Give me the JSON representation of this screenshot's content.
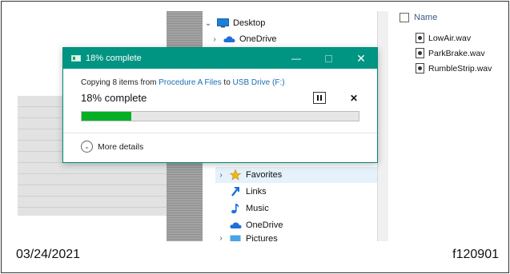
{
  "nav": {
    "items": [
      {
        "label": "Desktop",
        "icon": "desktop-icon",
        "chevron": "⌄"
      },
      {
        "label": "OneDrive",
        "icon": "cloud-icon",
        "chevron": "›"
      },
      {
        "label": "Favorites",
        "icon": "star-icon",
        "chevron": "›"
      },
      {
        "label": "Links",
        "icon": "link-icon",
        "chevron": ""
      },
      {
        "label": "Music",
        "icon": "music-note-icon",
        "chevron": ""
      },
      {
        "label": "OneDrive",
        "icon": "cloud-icon",
        "chevron": ""
      },
      {
        "label": "Pictures",
        "icon": "pictures-icon",
        "chevron": "›"
      }
    ]
  },
  "files": {
    "header": "Name",
    "items": [
      "LowAir.wav",
      "ParkBrake.wav",
      "RumbleStrip.wav"
    ]
  },
  "dialog": {
    "title": "18% complete",
    "copy_prefix": "Copying 8 items from",
    "source": "Procedure A Files",
    "to_word": "to",
    "destination": "USB Drive (F:)",
    "percent_label": "18% complete",
    "progress": 0.18,
    "more_details": "More details",
    "minimize_glyph": "—",
    "close_glyph": "✕",
    "cancel_glyph": "✕"
  },
  "footer": {
    "date": "03/24/2021",
    "code": "f120901"
  },
  "colors": {
    "accent": "#009482",
    "progress": "#06b025",
    "link": "#1a6fb5",
    "onedrive": "#1e6fd9",
    "star": "#f2b51c"
  }
}
